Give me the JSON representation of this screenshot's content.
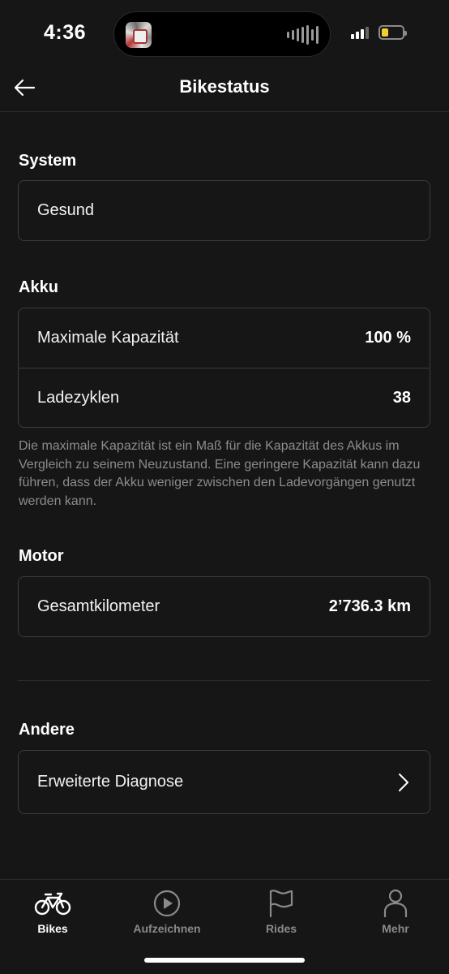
{
  "status_bar": {
    "time": "4:36"
  },
  "nav": {
    "title": "Bikestatus"
  },
  "system": {
    "title": "System",
    "value": "Gesund"
  },
  "akku": {
    "title": "Akku",
    "rows": [
      {
        "label": "Maximale Kapazität",
        "value": "100 %"
      },
      {
        "label": "Ladezyklen",
        "value": "38"
      }
    ],
    "footnote": "Die maximale Kapazität ist ein Maß für die Kapazität des Akkus im Vergleich zu seinem Neuzustand. Eine geringere Kapazität kann dazu führen, dass der Akku weniger zwischen den Ladevorgängen genutzt werden kann."
  },
  "motor": {
    "title": "Motor",
    "rows": [
      {
        "label": "Gesamtkilometer",
        "value": "2’736.3 km"
      }
    ]
  },
  "andere": {
    "title": "Andere",
    "rows": [
      {
        "label": "Erweiterte Diagnose"
      }
    ]
  },
  "tabs": [
    {
      "label": "Bikes",
      "icon": "bike-icon",
      "active": true
    },
    {
      "label": "Aufzeichnen",
      "icon": "play-circle-icon",
      "active": false
    },
    {
      "label": "Rides",
      "icon": "flag-icon",
      "active": false
    },
    {
      "label": "Mehr",
      "icon": "person-icon",
      "active": false
    }
  ],
  "colors": {
    "background": "#161616",
    "card_border": "#3c3c3c",
    "muted_text": "#8c8c8c",
    "battery_level": "#f5cd2f"
  }
}
